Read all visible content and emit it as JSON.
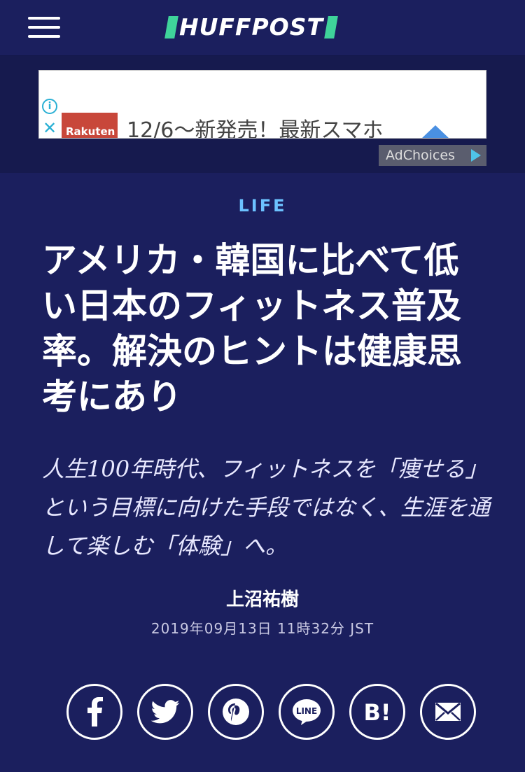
{
  "header": {
    "logo_text": "HUFFPOST",
    "menu_icon": "hamburger-menu-icon"
  },
  "ad": {
    "advertiser": "Rakuten",
    "text": "12/6〜新発売！最新スマホ",
    "adchoices_label": "AdChoices",
    "info_icon": "info-icon",
    "close_icon": "close-icon"
  },
  "article": {
    "category": "LIFE",
    "headline": "アメリカ・韓国に比べて低い日本のフィットネス普及率。解決のヒントは健康思考にあり",
    "dek": "人生100年時代、フィットネスを「痩せる」という目標に向けた手段ではなく、生涯を通して楽しむ「体験」へ。",
    "author": "上沼祐樹",
    "date": "2019年09月13日 11時32分 JST"
  },
  "share": {
    "buttons": [
      {
        "name": "facebook",
        "icon": "facebook-icon"
      },
      {
        "name": "twitter",
        "icon": "twitter-icon"
      },
      {
        "name": "pinterest",
        "icon": "pinterest-icon"
      },
      {
        "name": "line",
        "icon": "line-icon",
        "label": "LINE"
      },
      {
        "name": "hatena",
        "icon": "hatena-bookmark-icon",
        "label": "B!"
      },
      {
        "name": "email",
        "icon": "email-icon"
      }
    ]
  },
  "colors": {
    "background": "#1b1f5e",
    "accent_green": "#3fd39a",
    "category_blue": "#6cc2ff"
  }
}
